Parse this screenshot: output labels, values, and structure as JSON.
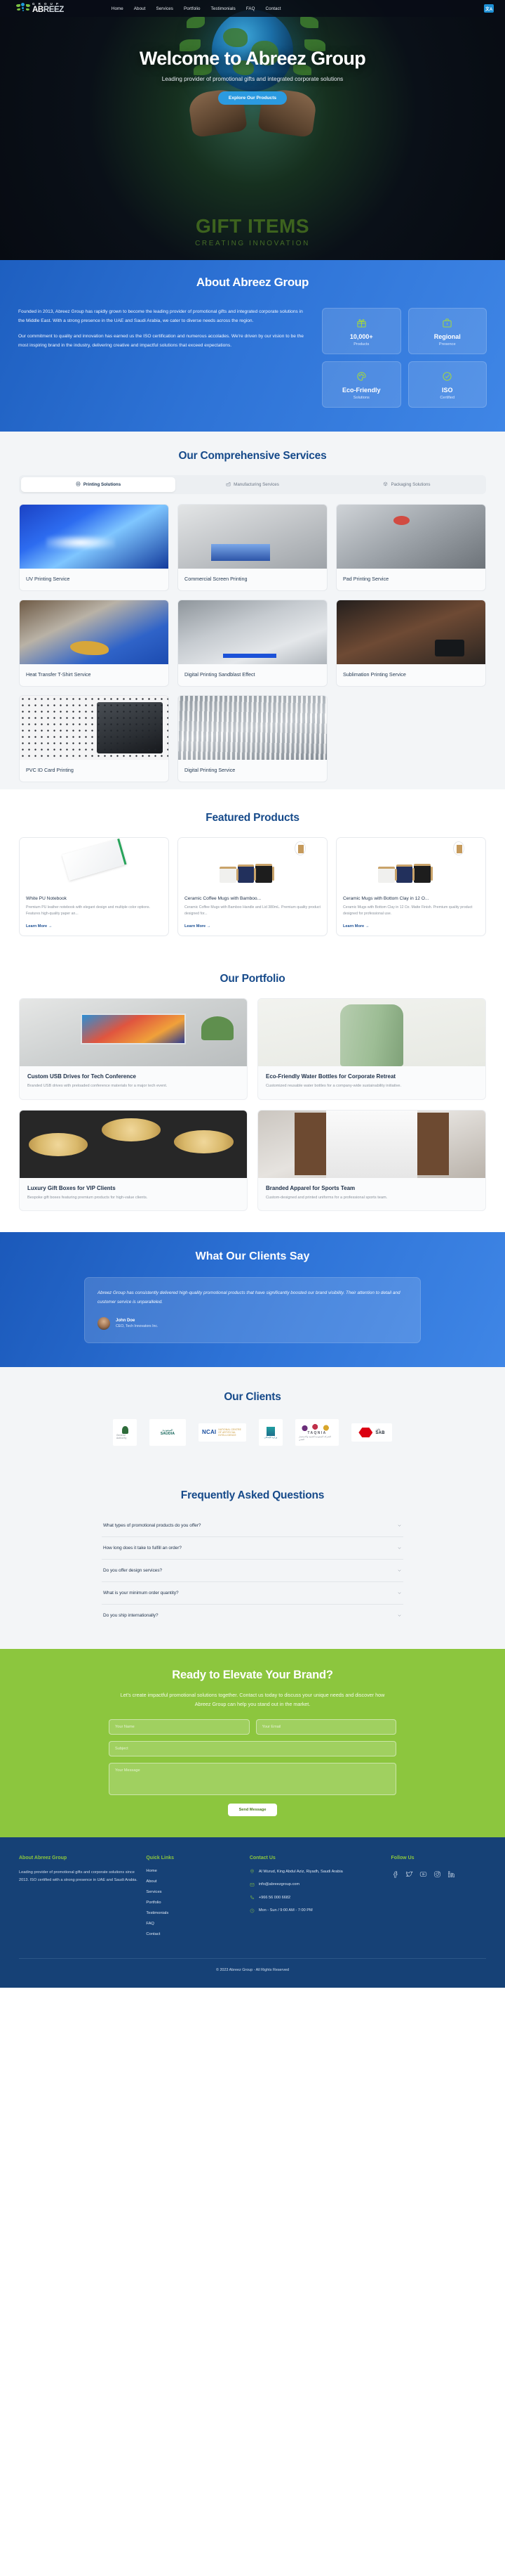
{
  "brand": {
    "prefix": "AB",
    "suffix": "REEZ",
    "group": "G R O U P",
    "lang": "文A"
  },
  "nav": {
    "links": [
      "Home",
      "About",
      "Services",
      "Portfolio",
      "Testimonials",
      "FAQ",
      "Contact"
    ]
  },
  "hero": {
    "title": "Welcome to Abreez Group",
    "subtitle": "Leading provider of promotional gifts and integrated corporate solutions",
    "cta": "Explore Our Products",
    "banner_title": "GIFT ITEMS",
    "banner_sub": "CREATING INNOVATION"
  },
  "about": {
    "title": "About Abreez Group",
    "paragraphs": [
      "Founded in 2013, Abreez Group has rapidly grown to become the leading provider of promotional gifts and integrated corporate solutions in the Middle East. With a strong presence in the UAE and Saudi Arabia, we cater to diverse needs across the region.",
      "Our commitment to quality and innovation has earned us the ISO certification and numerous accolades. We're driven by our vision to be the most inspiring brand in the industry, delivering creative and impactful solutions that exceed expectations."
    ],
    "stats": [
      {
        "icon": "gift-icon",
        "value": "10,000+",
        "label": "Products"
      },
      {
        "icon": "briefcase-icon",
        "value": "Regional",
        "label": "Presence"
      },
      {
        "icon": "palette-icon",
        "value": "Eco-Friendly",
        "label": "Solutions"
      },
      {
        "icon": "check-circle-icon",
        "value": "ISO",
        "label": "Certified"
      }
    ]
  },
  "services": {
    "title": "Our Comprehensive Services",
    "tabs": [
      {
        "label": "Printing Solutions",
        "icon": "printer-icon",
        "active": true
      },
      {
        "label": "Manufacturing Services",
        "icon": "factory-icon",
        "active": false
      },
      {
        "label": "Packaging Solutions",
        "icon": "package-icon",
        "active": false
      }
    ],
    "items": [
      {
        "label": "UV Printing Service",
        "img": "img-uv"
      },
      {
        "label": "Commercial Screen Printing",
        "img": "img-screen"
      },
      {
        "label": "Pad Printing Service",
        "img": "img-pad"
      },
      {
        "label": "Heat Transfer T-Shirt Service",
        "img": "img-heat"
      },
      {
        "label": "Digital Printing Sandblast Effect",
        "img": "img-sand"
      },
      {
        "label": "Sublimation Printing Service",
        "img": "img-subl"
      },
      {
        "label": "PVC ID Card Printing",
        "img": "img-pvc"
      },
      {
        "label": "Digital Printing Service",
        "img": "img-digital"
      }
    ]
  },
  "featured": {
    "title": "Featured Products",
    "link_label": "Learn More",
    "items": [
      {
        "title": "White PU Notebook",
        "desc": "Premium PU leather notebook with elegant design and multiple color options. Features high-quality paper an...",
        "kind": "notebook"
      },
      {
        "title": "Ceramic Coffee Mugs with Bamboo...",
        "desc": "Ceramic Coffee Mugs with Bamboo Handle and Lid 380mL. Premium quality product designed for...",
        "kind": "mugs"
      },
      {
        "title": "Ceramic Mugs with Bottom Clay in 12 O...",
        "desc": "Ceramic Mugs with Bottom Clay in 12 Oz. Matte Finish. Premium quality product designed for professional use.",
        "kind": "mugs"
      }
    ]
  },
  "portfolio": {
    "title": "Our Portfolio",
    "items": [
      {
        "title": "Custom USB Drives for Tech Conference",
        "desc": "Branded USB drives with preloaded conference materials for a major tech event.",
        "img": "f-usb"
      },
      {
        "title": "Eco-Friendly Water Bottles for Corporate Retreat",
        "desc": "Customized reusable water bottles for a company-wide sustainability initiative.",
        "img": "f-bottle"
      },
      {
        "title": "Luxury Gift Boxes for VIP Clients",
        "desc": "Bespoke gift boxes featuring premium products for high-value clients.",
        "img": "f-gift"
      },
      {
        "title": "Branded Apparel for Sports Team",
        "desc": "Custom-designed and printed uniforms for a professional sports team.",
        "img": "f-app"
      }
    ]
  },
  "testimonials": {
    "title": "What Our Clients Say",
    "quote": "Abreez Group has consistently delivered high-quality promotional products that have significantly boosted our brand visibility. Their attention to detail and customer service is unparalleled.",
    "author": "John Doe",
    "role": "CEO, Tech Innovators Inc."
  },
  "clients": {
    "title": "Our Clients",
    "logos": [
      {
        "main": "ARS",
        "sub": "General Authority"
      },
      {
        "main": "SAUDIA",
        "sub": "السعودية"
      },
      {
        "main": "NCAI",
        "sub": "NATIONAL CENTRE OF ARTIFICIAL INTELLIGENCE"
      },
      {
        "main": "وزارة الإسكان",
        "sub": "MINISTRY OF HOUSING"
      },
      {
        "main": "TAQNIA",
        "sub": "الشركة السعودية للتنمية والاستثمار التقني"
      },
      {
        "main": "SAB",
        "sub": "الأول"
      }
    ]
  },
  "faq": {
    "title": "Frequently Asked Questions",
    "items": [
      "What types of promotional products do you offer?",
      "How long does it take to fulfill an order?",
      "Do you offer design services?",
      "What is your minimum order quantity?",
      "Do you ship internationally?"
    ]
  },
  "cta": {
    "title": "Ready to Elevate Your Brand?",
    "subtitle": "Let's create impactful promotional solutions together. Contact us today to discuss your unique needs and discover how Abreez Group can help you stand out in the market.",
    "name_placeholder": "Your Name",
    "email_placeholder": "Your Email",
    "subject_placeholder": "Subject",
    "message_placeholder": "Your Message",
    "submit_label": "Send Message"
  },
  "footer": {
    "about_heading": "About Abreez Group",
    "about_text": "Leading provider of promotional gifts and corporate solutions since 2013. ISO certified with a strong presence in UAE and Saudi Arabia.",
    "links_heading": "Quick Links",
    "links": [
      "Home",
      "About",
      "Services",
      "Portfolio",
      "Testimonials",
      "FAQ",
      "Contact"
    ],
    "contact_heading": "Contact Us",
    "contacts": [
      {
        "icon": "map-pin-icon",
        "text": "Al Wurud, King Abdul Aziz, Riyadh, Saudi Arabia"
      },
      {
        "icon": "envelope-icon",
        "text": "info@abreezgroup.com"
      },
      {
        "icon": "phone-icon",
        "text": "+966 56 000 6682"
      },
      {
        "icon": "clock-icon",
        "text": "Mon - Sun / 9:00 AM - 7:00 PM"
      }
    ],
    "follow_heading": "Follow Us",
    "socials": [
      "facebook-icon",
      "twitter-icon",
      "youtube-icon",
      "instagram-icon",
      "linkedin-icon"
    ],
    "copyright": "© 2023 Abreez Group - All Rights Reserved"
  },
  "colors": {
    "blue": "#164a8a",
    "accent_blue": "#2b9ae0",
    "green": "#8cc63e",
    "footer": "#164176"
  }
}
